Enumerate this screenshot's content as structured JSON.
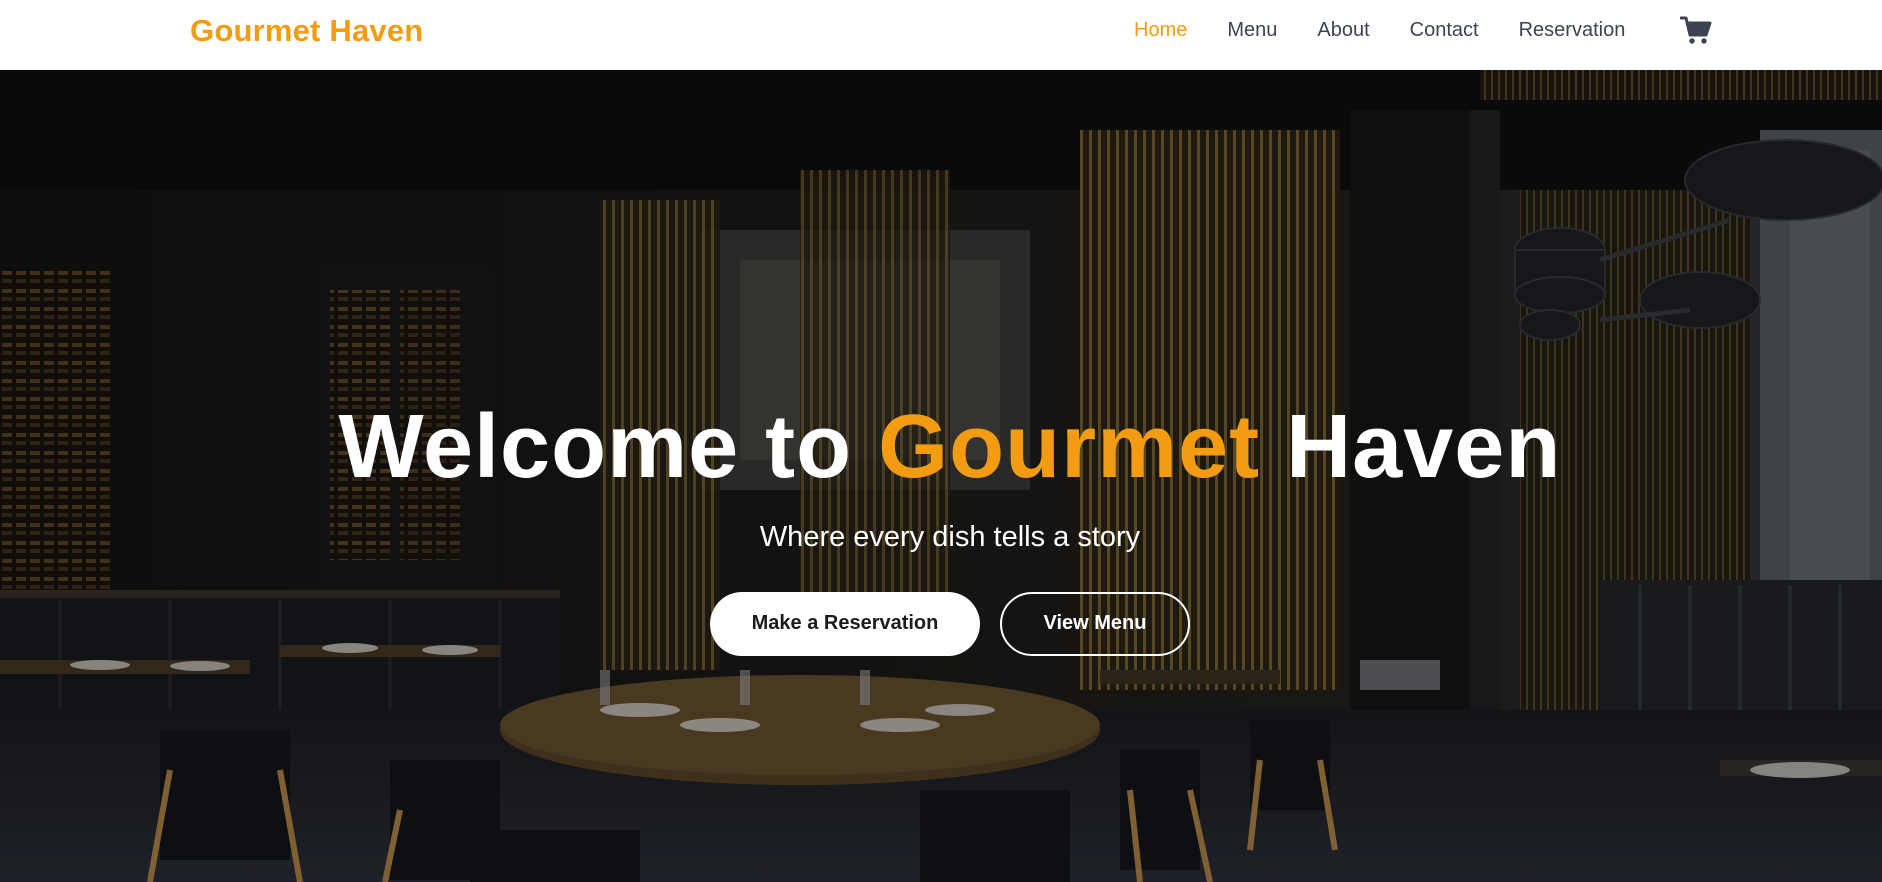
{
  "colors": {
    "accent": "#f39c12",
    "nav_text": "#3d4451",
    "nav_background": "#ffffff",
    "hero_text": "#ffffff"
  },
  "header": {
    "brand": "Gourmet Haven",
    "nav": [
      {
        "label": "Home",
        "active": true
      },
      {
        "label": "Menu",
        "active": false
      },
      {
        "label": "About",
        "active": false
      },
      {
        "label": "Contact",
        "active": false
      },
      {
        "label": "Reservation",
        "active": false
      }
    ],
    "cart_icon": "shopping-cart-icon"
  },
  "hero": {
    "title_prefix": "Welcome to",
    "title_accent": "Gourmet",
    "title_suffix": "Haven",
    "subtitle": "Where every dish tells a story",
    "primary_button": "Make a Reservation",
    "secondary_button": "View Menu",
    "background": "restaurant-interior-photo"
  }
}
